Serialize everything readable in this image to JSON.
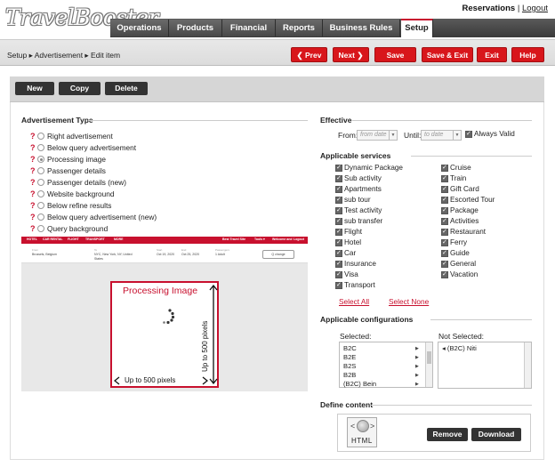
{
  "app": {
    "logo": "TravelBooster"
  },
  "top_links": {
    "reservations": "Reservations",
    "separator": "|",
    "logout": "Logout"
  },
  "nav_tabs": [
    {
      "label": "Operations",
      "active": false
    },
    {
      "label": "Products",
      "active": false
    },
    {
      "label": "Financial",
      "active": false
    },
    {
      "label": "Reports",
      "active": false
    },
    {
      "label": "Business Rules",
      "active": false
    },
    {
      "label": "Setup",
      "active": true
    }
  ],
  "breadcrumb": "Setup ▸ Advertisement ▸ Edit item",
  "actions": {
    "prev": "❮ Prev",
    "next": "Next ❯",
    "save": "Save",
    "save_exit": "Save & Exit",
    "exit": "Exit",
    "help": "Help"
  },
  "toolbar": {
    "new": "New",
    "copy": "Copy",
    "delete": "Delete"
  },
  "ad_type": {
    "title": "Advertisement Type",
    "options": [
      {
        "label": "Right advertisement",
        "selected": false
      },
      {
        "label": "Below query advertisement",
        "selected": false
      },
      {
        "label": "Processing image",
        "selected": true
      },
      {
        "label": "Passenger details",
        "selected": false
      },
      {
        "label": "Passenger details (new)",
        "selected": false
      },
      {
        "label": "Website background",
        "selected": false
      },
      {
        "label": "Below refine results",
        "selected": false
      },
      {
        "label": "Below query advertisement (new)",
        "selected": false
      },
      {
        "label": "Query background",
        "selected": false
      }
    ]
  },
  "preview": {
    "nav": [
      "HOTEL",
      "CAR RENTAL",
      "FLIGHT",
      "TRANSPORT",
      "MORE"
    ],
    "nav_right": [
      "Best Travel Site",
      "Tools ▾",
      "Welcome and",
      "Logout"
    ],
    "fields": [
      {
        "label": "From",
        "value": "Brussels, Belgium"
      },
      {
        "label": "To",
        "value": "NYC, New York, NY, United States"
      },
      {
        "label": "Start",
        "value": "Oct 19, 2020"
      },
      {
        "label": "End",
        "value": "Oct 25, 2020"
      },
      {
        "label": "Passengers",
        "value": "1 Adult"
      }
    ],
    "change": "Q change",
    "title": "Processing Image",
    "width_note": "Up to 500 pixels",
    "height_note": "Up to 500 pixels"
  },
  "effective": {
    "title": "Effective",
    "from_label": "From:",
    "from_placeholder": "from date",
    "until_label": "Until:",
    "until_placeholder": "to date",
    "always_valid": "Always Valid"
  },
  "services": {
    "title": "Applicable services",
    "left": [
      "Dynamic Package",
      "Sub activity",
      "Apartments",
      "sub tour",
      "Test activity",
      "sub transfer",
      "Flight",
      "Hotel",
      "Car",
      "Insurance",
      "Visa",
      "Transport"
    ],
    "right": [
      "Cruise",
      "Train",
      "Gift Card",
      "Escorted Tour",
      "Package",
      "Activities",
      "Restaurant",
      "Ferry",
      "Guide",
      "General",
      "Vacation"
    ],
    "select_all": "Select All",
    "select_none": "Select None"
  },
  "configurations": {
    "title": "Applicable configurations",
    "selected_label": "Selected:",
    "not_selected_label": "Not Selected:",
    "selected": [
      "B2C",
      "B2E",
      "B2S",
      "B2B",
      "(B2C) Bein"
    ],
    "not_selected": [
      "◂ (B2C) Niti"
    ]
  },
  "define_content": {
    "title": "Define content",
    "icon_text": "HTML",
    "remove": "Remove",
    "download": "Download"
  },
  "colors": {
    "brand_red": "#c8102e",
    "button_red": "#d8161b",
    "dark_button": "#333333",
    "tab_dark": "#4a4a4a"
  }
}
